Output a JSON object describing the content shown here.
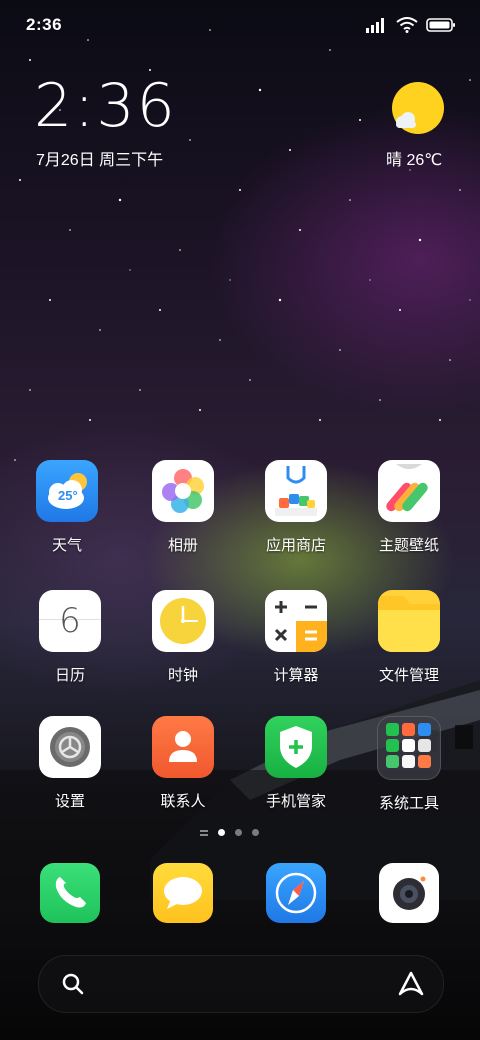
{
  "status_bar": {
    "time": "2:36"
  },
  "clock_widget": {
    "time": "2:36",
    "date": "7月26日 周三下午"
  },
  "weather_widget": {
    "text": "晴 26℃",
    "icon": "sunny-partly-cloudy-icon"
  },
  "apps": [
    {
      "label": "天气",
      "icon": "weather-icon",
      "badge_text": "25°"
    },
    {
      "label": "相册",
      "icon": "gallery-icon"
    },
    {
      "label": "应用商店",
      "icon": "app-store-icon"
    },
    {
      "label": "主题壁纸",
      "icon": "themes-icon"
    },
    {
      "label": "日历",
      "icon": "calendar-icon",
      "badge_text": "6"
    },
    {
      "label": "时钟",
      "icon": "clock-icon"
    },
    {
      "label": "计算器",
      "icon": "calculator-icon"
    },
    {
      "label": "文件管理",
      "icon": "folder-icon"
    },
    {
      "label": "设置",
      "icon": "settings-gear-icon"
    },
    {
      "label": "联系人",
      "icon": "contacts-icon"
    },
    {
      "label": "手机管家",
      "icon": "security-shield-icon"
    },
    {
      "label": "系统工具",
      "icon": "folder-grid-icon"
    }
  ],
  "page_indicator": {
    "pages": 3,
    "active_index": 0
  },
  "dock": [
    {
      "icon": "phone-icon"
    },
    {
      "icon": "messages-icon"
    },
    {
      "icon": "browser-compass-icon"
    },
    {
      "icon": "camera-icon"
    }
  ],
  "search_bar": {
    "left_icon": "search-icon",
    "right_icon": "assistant-icon"
  },
  "colors": {
    "weather_tile": "#2f8cf0",
    "clock_face": "#f7d43c",
    "folder_yellow": "#ffd23c",
    "contacts_orange": "#f4693f",
    "security_green": "#23c24e",
    "phone_green": "#2ed46a",
    "messages_yellow": "#ffd22e",
    "browser_blue": "#2f8cf0",
    "sun_yellow": "#ffd21f"
  }
}
